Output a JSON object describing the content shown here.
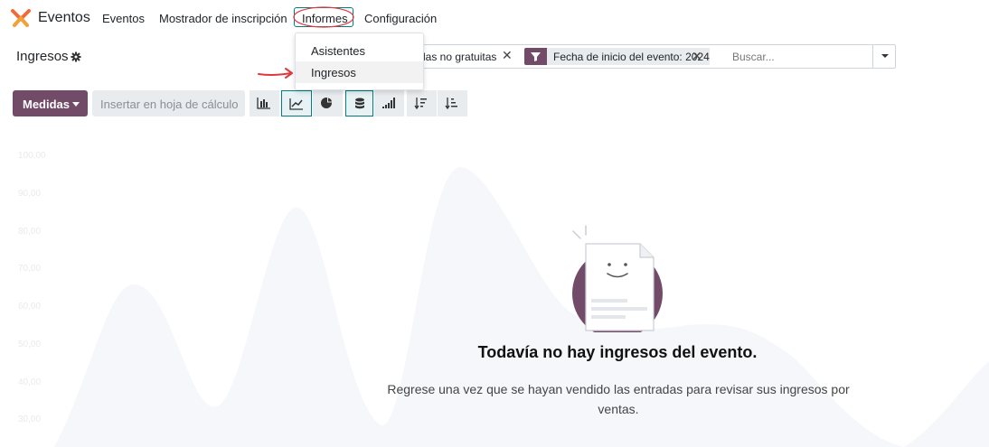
{
  "app": {
    "name": "Eventos"
  },
  "nav": {
    "items": [
      "Eventos",
      "Mostrador de inscripción",
      "Informes",
      "Configuración"
    ]
  },
  "dropdown": {
    "items": [
      "Asistentes",
      "Ingresos"
    ],
    "active": "Ingresos"
  },
  "control": {
    "breadcrumb": "Ingresos",
    "facets": [
      {
        "label": "las no gratuitas"
      },
      {
        "label": "Fecha de inicio del evento: 2024"
      }
    ],
    "search_placeholder": "Buscar..."
  },
  "toolbar": {
    "measures_label": "Medidas",
    "spreadsheet_label": "Insertar en hoja de cálculo"
  },
  "chart_bg": {
    "yticks": [
      "100,00",
      "90,00",
      "80,00",
      "70,00",
      "60,00",
      "50,00",
      "40,00",
      "30,00"
    ]
  },
  "helper": {
    "title": "Todavía no hay ingresos del evento.",
    "text": "Regrese una vez que se hayan vendido las entradas para revisar sus ingresos por ventas."
  },
  "colors": {
    "brand": "#714b67",
    "accent": "#017e84",
    "annotation": "#e0383e"
  }
}
